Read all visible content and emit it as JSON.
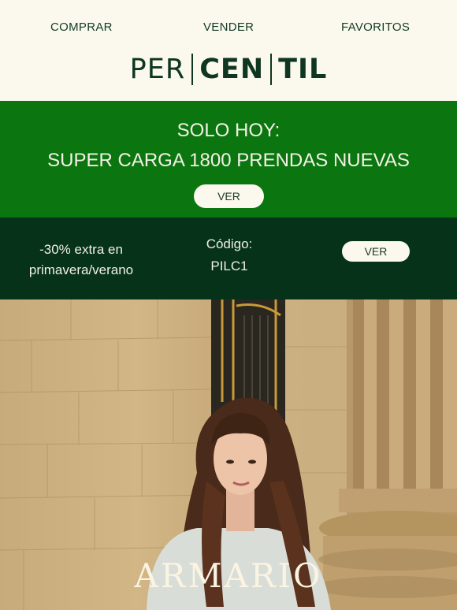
{
  "nav": {
    "buy": "COMPRAR",
    "sell": "VENDER",
    "favorites": "FAVORITOS"
  },
  "logo": {
    "part1": "PER",
    "part2": "CEN",
    "part3": "TIL"
  },
  "promo": {
    "line1": "SOLO HOY:",
    "line2": "SUPER CARGA 1800 PRENDAS NUEVAS",
    "button": "VER"
  },
  "code_banner": {
    "offer_line1": "-30% extra en",
    "offer_line2": "primavera/verano",
    "code_label": "Código:",
    "code_value": "PILC1",
    "button": "VER"
  },
  "hero": {
    "title": "ARMARIO"
  },
  "colors": {
    "cream": "#fbf8ee",
    "green": "#0b760f",
    "dark_green": "#053218",
    "text_green": "#0e3620"
  }
}
